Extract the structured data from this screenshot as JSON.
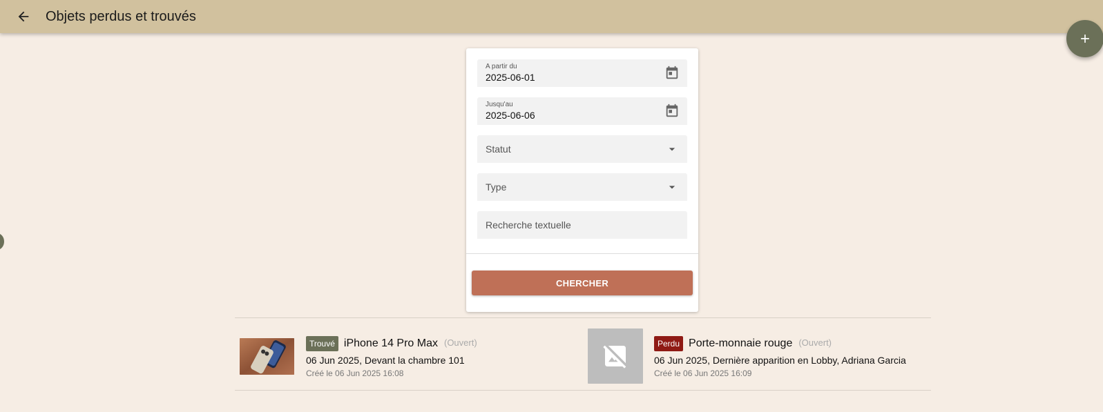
{
  "header": {
    "title": "Objets perdus et trouvés",
    "back_icon": "arrow-left-icon"
  },
  "fab": {
    "icon": "plus-icon"
  },
  "filters": {
    "from": {
      "label": "A partir du",
      "value": "2025-06-01"
    },
    "to": {
      "label": "Jusqu'au",
      "value": "2025-06-06"
    },
    "status": {
      "placeholder": "Statut"
    },
    "type": {
      "placeholder": "Type"
    },
    "text_search": {
      "placeholder": "Recherche textuelle"
    },
    "search_label": "CHERCHER"
  },
  "results": [
    {
      "badge": "Trouvé",
      "name": "iPhone 14 Pro Max",
      "status": "(Ouvert)",
      "detail": "06 Jun 2025, Devant la chambre 101",
      "created": "Créé le 06 Jun 2025 16:08"
    },
    {
      "badge": "Perdu",
      "name": "Porte-monnaie rouge",
      "status": "(Ouvert)",
      "detail": "06 Jun 2025, Dernière apparition en Lobby, Adriana Garcia",
      "created": "Créé le 06 Jun 2025 16:09"
    }
  ],
  "colors": {
    "app_bar": "#d1c19e",
    "background": "#f6ede4",
    "accent_button": "#bf7057",
    "badge_found": "#6b7058",
    "badge_lost": "#8f1a14",
    "fab": "#6b7058"
  }
}
